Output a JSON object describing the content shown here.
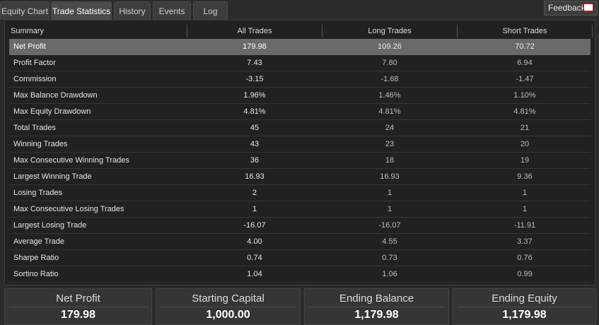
{
  "tabs": [
    {
      "label": "Equity Chart",
      "active": false
    },
    {
      "label": "Trade Statistics",
      "active": true
    },
    {
      "label": "History",
      "active": false
    },
    {
      "label": "Events",
      "active": false
    },
    {
      "label": "Log",
      "active": false
    }
  ],
  "feedback": {
    "label": "Feedback",
    "icon": "speech-bubble-icon"
  },
  "table": {
    "headers": [
      "Summary",
      "All Trades",
      "Long Trades",
      "Short Trades"
    ],
    "rows": [
      [
        "Net Profit",
        "179.98",
        "109.26",
        "70.72"
      ],
      [
        "Profit Factor",
        "7.43",
        "7.80",
        "6.94"
      ],
      [
        "Commission",
        "-3.15",
        "-1.68",
        "-1.47"
      ],
      [
        "Max Balance Drawdown",
        "1.96%",
        "1.46%",
        "1.10%"
      ],
      [
        "Max Equity Drawdown",
        "4.81%",
        "4.81%",
        "4.81%"
      ],
      [
        "Total Trades",
        "45",
        "24",
        "21"
      ],
      [
        "Winning Trades",
        "43",
        "23",
        "20"
      ],
      [
        "Max Consecutive Winning Trades",
        "36",
        "18",
        "19"
      ],
      [
        "Largest Winning Trade",
        "16.93",
        "16.93",
        "9.36"
      ],
      [
        "Losing Trades",
        "2",
        "1",
        "1"
      ],
      [
        "Max Consecutive Losing Trades",
        "1",
        "1",
        "1"
      ],
      [
        "Largest Losing Trade",
        "-16.07",
        "-16.07",
        "-11.91"
      ],
      [
        "Average Trade",
        "4.00",
        "4.55",
        "3.37"
      ],
      [
        "Sharpe Ratio",
        "0.74",
        "0.73",
        "0.76"
      ],
      [
        "Sortino Ratio",
        "1.04",
        "1.06",
        "0.99"
      ]
    ],
    "selected_row": 0
  },
  "cards": [
    {
      "title": "Net Profit",
      "value": "179.98"
    },
    {
      "title": "Starting Capital",
      "value": "1,000.00"
    },
    {
      "title": "Ending Balance",
      "value": "1,179.98"
    },
    {
      "title": "Ending Equity",
      "value": "1,179.98"
    }
  ],
  "colors": {
    "accent_red": "#d02020",
    "selected_row": "#6a6a6a"
  }
}
